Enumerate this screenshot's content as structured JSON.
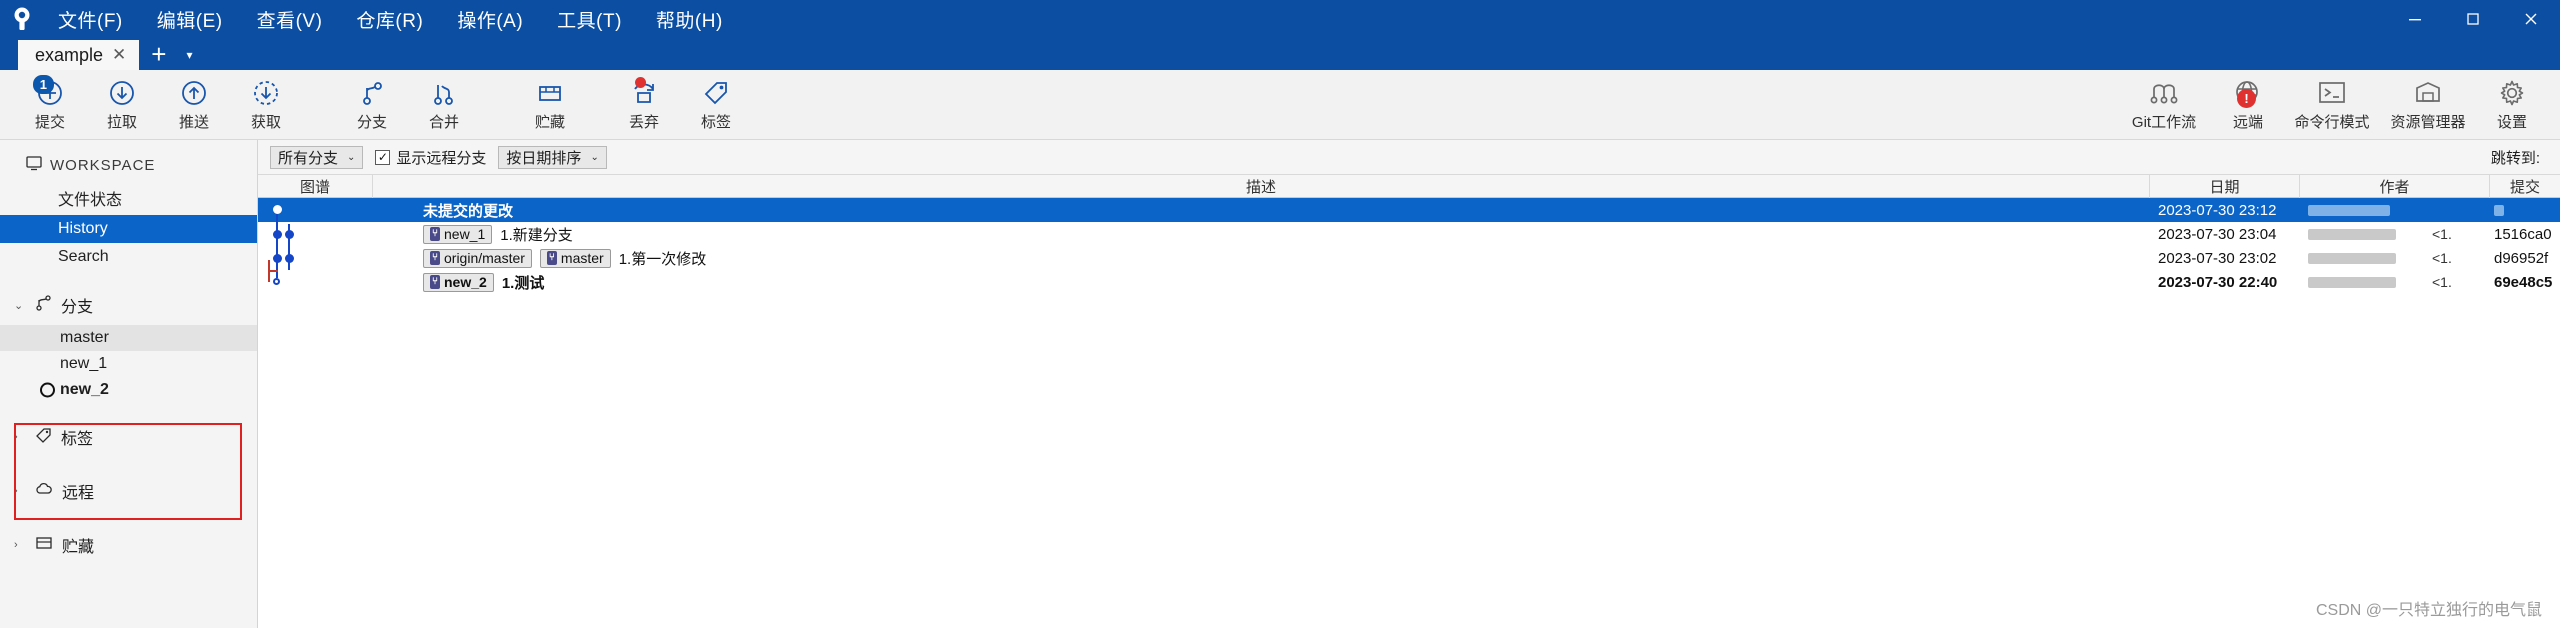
{
  "window": {
    "app_icon": "tortoisegit-logo-icon",
    "menus": [
      {
        "label": "文件(F)",
        "name": "menu-file"
      },
      {
        "label": "编辑(E)",
        "name": "menu-edit"
      },
      {
        "label": "查看(V)",
        "name": "menu-view"
      },
      {
        "label": "仓库(R)",
        "name": "menu-repo"
      },
      {
        "label": "操作(A)",
        "name": "menu-action"
      },
      {
        "label": "工具(T)",
        "name": "menu-tools"
      },
      {
        "label": "帮助(H)",
        "name": "menu-help"
      }
    ],
    "controls": {
      "minimize": "─",
      "maximize": "□",
      "close": "✕"
    }
  },
  "tabs": {
    "items": [
      {
        "label": "example",
        "close": "✕",
        "active": true
      }
    ],
    "new_tab": "+",
    "dropdown": "▾"
  },
  "toolbar": {
    "left": [
      {
        "label": "提交",
        "icon": "commit-plus-icon",
        "badge": "1",
        "name": "toolbar-commit"
      },
      {
        "label": "拉取",
        "icon": "pull-down-arrow-icon",
        "name": "toolbar-pull"
      },
      {
        "label": "推送",
        "icon": "push-up-arrow-icon",
        "name": "toolbar-push"
      },
      {
        "label": "获取",
        "icon": "fetch-dashed-arrow-icon",
        "name": "toolbar-fetch"
      },
      {
        "label": "分支",
        "icon": "branch-icon",
        "name": "toolbar-branch"
      },
      {
        "label": "合并",
        "icon": "merge-icon",
        "name": "toolbar-merge"
      },
      {
        "label": "贮藏",
        "icon": "stash-box-icon",
        "name": "toolbar-stash"
      },
      {
        "label": "丢弃",
        "icon": "discard-arrow-icon",
        "badge_dot": true,
        "name": "toolbar-discard"
      },
      {
        "label": "标签",
        "icon": "tag-icon",
        "name": "toolbar-tag"
      }
    ],
    "right": [
      {
        "label": "Git工作流",
        "icon": "gitflow-icon",
        "name": "toolbar-gitflow"
      },
      {
        "label": "远端",
        "icon": "globe-remote-icon",
        "alert": "!",
        "name": "toolbar-remote"
      },
      {
        "label": "命令行模式",
        "icon": "terminal-icon",
        "name": "toolbar-terminal"
      },
      {
        "label": "资源管理器",
        "icon": "explorer-folder-icon",
        "name": "toolbar-explorer"
      },
      {
        "label": "设置",
        "icon": "gear-icon",
        "name": "toolbar-settings"
      }
    ]
  },
  "sidebar": {
    "workspace": {
      "label": "WORKSPACE",
      "icon": "monitor-icon"
    },
    "workspace_items": [
      {
        "label": "文件状态",
        "name": "sidebar-item-file-status",
        "selected": false
      },
      {
        "label": "History",
        "name": "sidebar-item-history",
        "selected": true
      },
      {
        "label": "Search",
        "name": "sidebar-item-search",
        "selected": false
      }
    ],
    "sections": [
      {
        "label": "分支",
        "icon": "branch-icon",
        "arrow": "⌄",
        "expanded": true,
        "name": "sidebar-section-branches",
        "items": [
          {
            "label": "master",
            "current": false,
            "highlighted": true
          },
          {
            "label": "new_1",
            "current": false,
            "highlighted": false
          },
          {
            "label": "new_2",
            "current": true,
            "highlighted": false
          }
        ]
      },
      {
        "label": "标签",
        "icon": "tag-icon",
        "arrow": "›",
        "expanded": false,
        "name": "sidebar-section-tags",
        "items": []
      },
      {
        "label": "远程",
        "icon": "cloud-icon",
        "arrow": "›",
        "expanded": false,
        "name": "sidebar-section-remotes",
        "items": []
      },
      {
        "label": "贮藏",
        "icon": "stash-box-icon",
        "arrow": "›",
        "expanded": false,
        "name": "sidebar-section-stashes",
        "items": []
      }
    ]
  },
  "filterbar": {
    "branch_filter": {
      "value": "所有分支",
      "caret": "⌄"
    },
    "show_remote": {
      "label": "显示远程分支",
      "checked": true,
      "check_glyph": "✓"
    },
    "sort": {
      "value": "按日期排序",
      "caret": "⌄"
    },
    "jump_label": "跳转到:"
  },
  "log": {
    "columns": [
      {
        "label": "图谱",
        "name": "column-graph"
      },
      {
        "label": "描述",
        "name": "column-description"
      },
      {
        "label": "日期",
        "name": "column-date"
      },
      {
        "label": "作者",
        "name": "column-author"
      },
      {
        "label": "提交",
        "name": "column-commit"
      }
    ],
    "rows": [
      {
        "selected": true,
        "message": "未提交的更改",
        "message_bold": true,
        "refs": [],
        "date": "2023-07-30 23:12",
        "author": "",
        "sha": ""
      },
      {
        "selected": false,
        "message": "1.新建分支",
        "message_bold": false,
        "refs": [
          {
            "name": "new_1",
            "current": false
          }
        ],
        "date": "2023-07-30 23:04",
        "author": "",
        "sha": "1516ca0"
      },
      {
        "selected": false,
        "message": "1.第一次修改",
        "message_bold": false,
        "refs": [
          {
            "name": "origin/master",
            "current": false
          },
          {
            "name": "master",
            "current": false
          }
        ],
        "date": "2023-07-30 23:02",
        "author": "",
        "sha": "d96952f"
      },
      {
        "selected": false,
        "message": "1.测试",
        "message_bold": true,
        "refs": [
          {
            "name": "new_2",
            "current": true
          }
        ],
        "date": "2023-07-30 22:40",
        "author": "",
        "sha": "69e48c5"
      }
    ],
    "author_mask": "<1."
  },
  "watermark": "CSDN @一只特立独行的电气鼠",
  "colors": {
    "title_blue": "#0b4ea2",
    "selection_blue": "#0b64c8",
    "graph_blue": "#1546c8",
    "accent_red": "#e02020",
    "toolbar_bg": "#f2f2f2"
  }
}
